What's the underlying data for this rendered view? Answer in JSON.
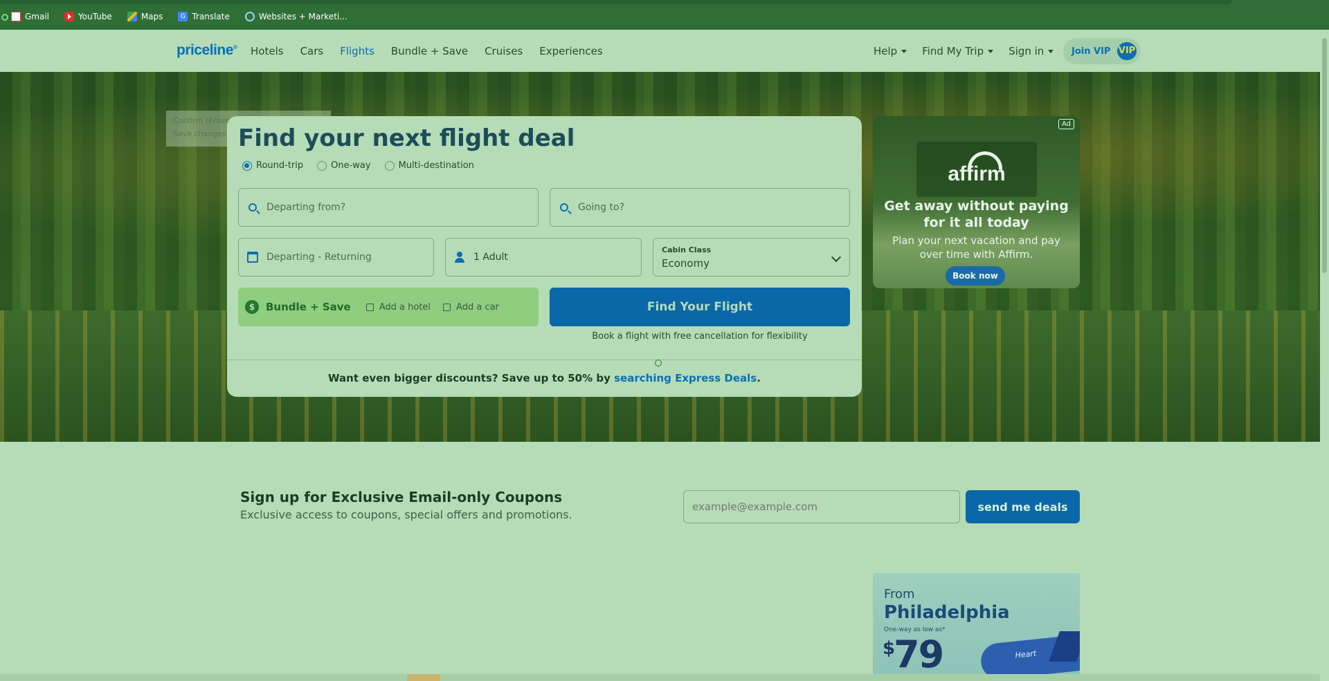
{
  "bookmarks": [
    {
      "label": "Gmail",
      "icon": "gmail-icon"
    },
    {
      "label": "YouTube",
      "icon": "youtube-icon"
    },
    {
      "label": "Maps",
      "icon": "maps-icon"
    },
    {
      "label": "Translate",
      "icon": "translate-icon"
    },
    {
      "label": "Websites + Marketi...",
      "icon": "website-icon"
    }
  ],
  "nav": {
    "logo": "priceline",
    "links": [
      "Hotels",
      "Cars",
      "Flights",
      "Bundle + Save",
      "Cruises",
      "Experiences"
    ],
    "active": "Flights",
    "right": [
      "Help",
      "Find My Trip",
      "Sign in"
    ],
    "join_vip": "Join VIP",
    "vip_badge": "VIP"
  },
  "ghost_tooltip": {
    "line1": "Confirm (Enter)",
    "line2": "Save changes and..."
  },
  "search": {
    "title": "Find your next flight deal",
    "trip_types": [
      "Round-trip",
      "One-way",
      "Multi-destination"
    ],
    "selected_trip": "Round-trip",
    "from_placeholder": "Departing from?",
    "to_placeholder": "Going to?",
    "dates_placeholder": "Departing - Returning",
    "passengers": "1 Adult",
    "cabin_label": "Cabin Class",
    "cabin_value": "Economy",
    "bundle_title": "Bundle + Save",
    "add_hotel": "Add a hotel",
    "add_car": "Add a car",
    "find_button": "Find Your Flight",
    "flex_note": "Book a flight with free cancellation for flexibility",
    "express_prefix": "Want even bigger discounts? Save up to 50% by",
    "express_link": "searching Express Deals",
    "express_suffix": "."
  },
  "ad": {
    "tag": "Ad",
    "brand": "affirm",
    "headline": "Get away without paying for it all today",
    "subtext": "Plan your next vacation and pay over time with Affirm.",
    "button": "Book now"
  },
  "signup": {
    "title": "Sign up for Exclusive Email-only Coupons",
    "subtitle": "Exclusive access to coupons, special offers and promotions.",
    "email_placeholder": "example@example.com",
    "button": "send me deals"
  },
  "promo": {
    "from": "From",
    "city": "Philadelphia",
    "oneway": "One-way as low as*",
    "currency": "$",
    "price": "79",
    "plane_text": "Heart"
  },
  "colors": {
    "brand_blue": "#0a6fb5",
    "button_blue": "#0a68a8",
    "page_bg": "#b5dcb6"
  }
}
